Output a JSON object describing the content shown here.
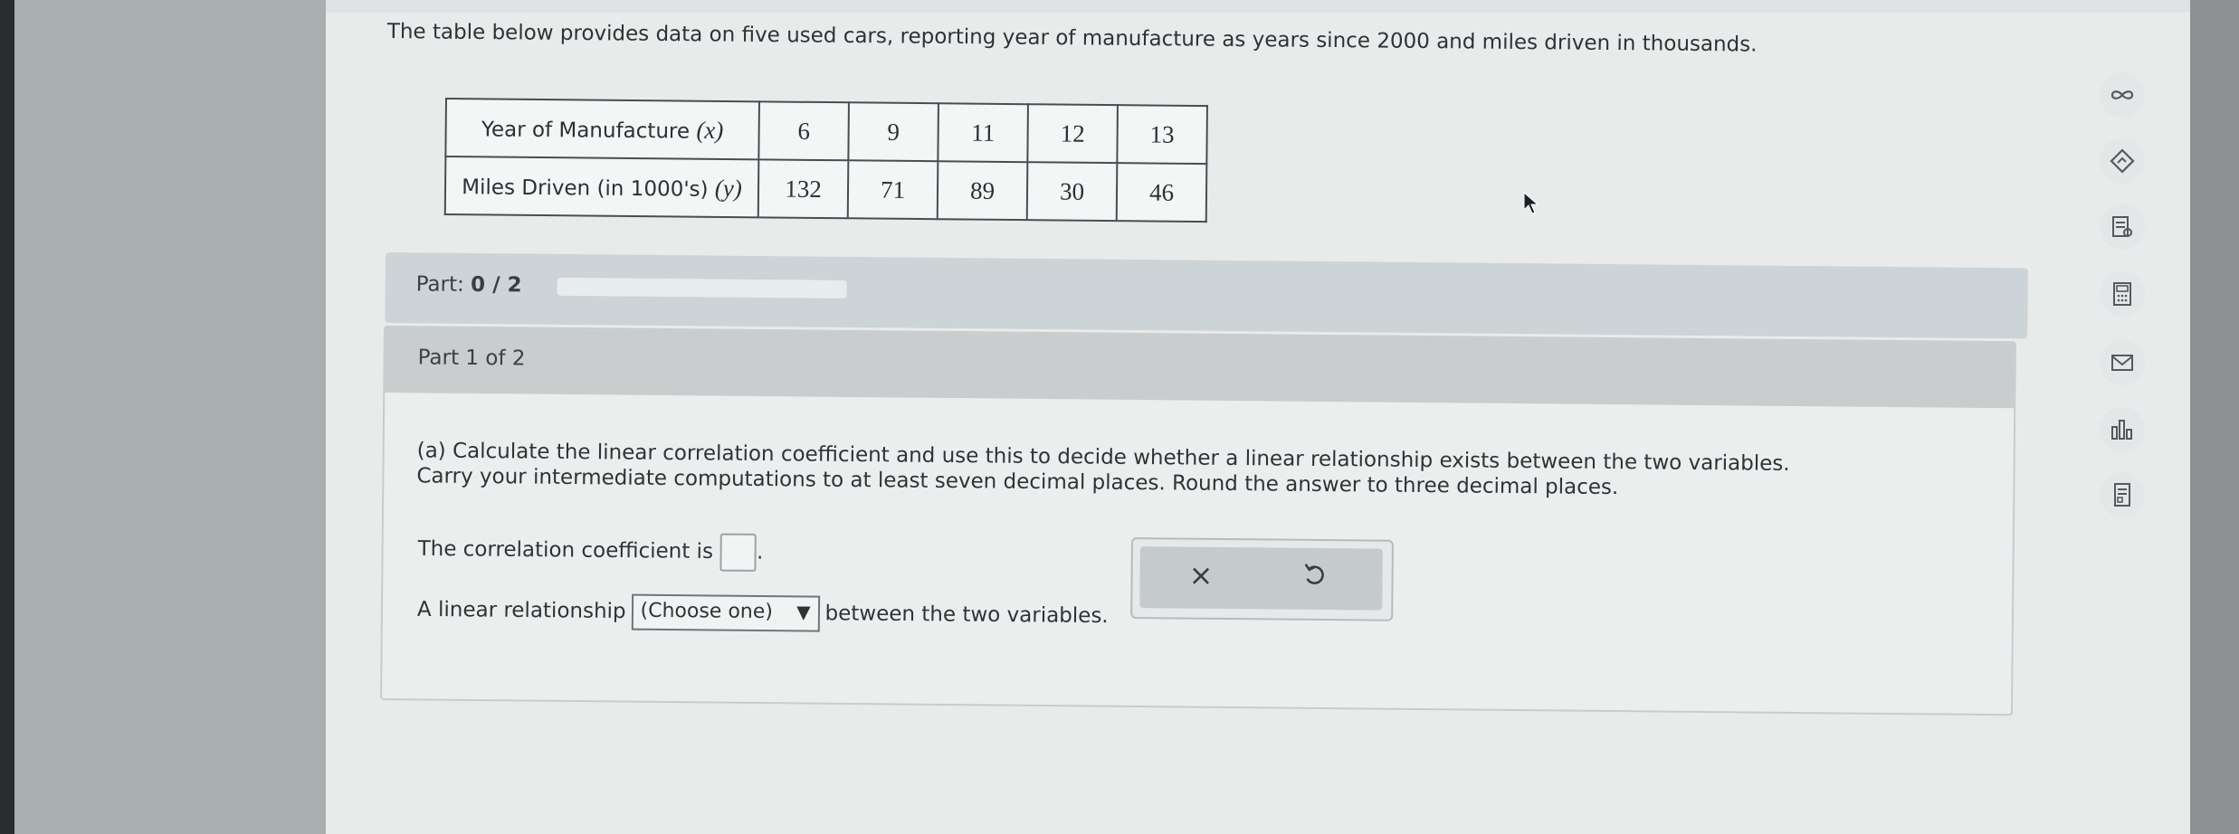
{
  "intro": {
    "text": "The table below provides data on five used cars, reporting year of manufacture as years since 2000 and miles driven in thousands."
  },
  "table": {
    "rows": [
      {
        "label": "Year of Manufacture ",
        "var": "(x)",
        "values": [
          "6",
          "9",
          "11",
          "12",
          "13"
        ]
      },
      {
        "label": "Miles Driven (in 1000's) ",
        "var": "(y)",
        "values": [
          "132",
          "71",
          "89",
          "30",
          "46"
        ]
      }
    ]
  },
  "part_progress": {
    "label": "Part: ",
    "value": "0 / 2",
    "fraction": 0
  },
  "part": {
    "header": "Part 1 of 2",
    "question": "(a) Calculate the linear correlation coefficient and use this to decide whether a linear relationship exists between the two variables. Carry your intermediate computations to at least seven decimal places. Round the answer to three decimal places.",
    "coef_prefix": "The correlation coefficient is",
    "coef_suffix": ".",
    "rel_prefix": "A linear relationship",
    "rel_select": "(Choose one)",
    "rel_select_arrow": "▼",
    "rel_suffix": "between the two variables."
  },
  "tools": {
    "clear_glyph": "×",
    "undo_icon": "undo-icon"
  },
  "side_icons": [
    "infinity-icon",
    "tag-icon",
    "notes-icon",
    "calculator-icon",
    "mail-icon",
    "chart-icon",
    "reference-icon"
  ],
  "colors": {
    "panel": "#e9ebeb",
    "part_bar": "#ccd4d7",
    "card_head": "#c9cdce",
    "progress_fill": "#6aa84f"
  }
}
